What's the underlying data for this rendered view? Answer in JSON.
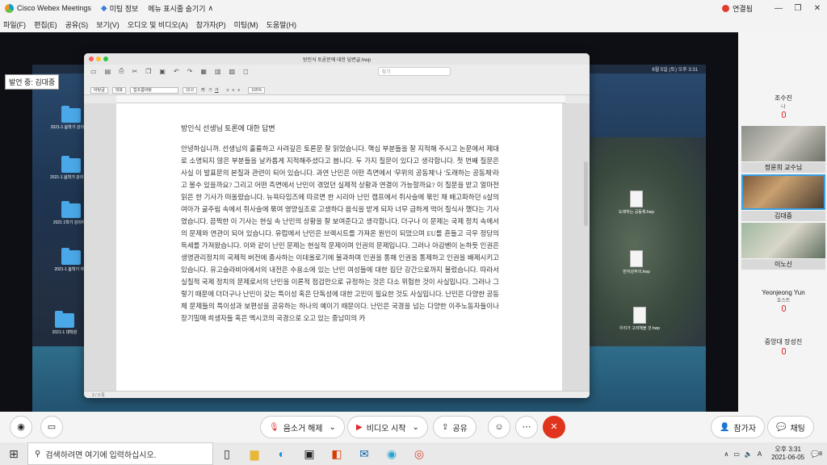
{
  "app": {
    "title": "Cisco Webex Meetings",
    "meeting_info": "미팅 정보",
    "menu_toggle": "메뉴 표시줄 숨기기",
    "connection": "연결됨"
  },
  "menu": [
    "파일(F)",
    "편집(E)",
    "공유(S)",
    "보기(V)",
    "오디오 및 비디오(A)",
    "참가자(P)",
    "미팅(M)",
    "도움말(H)"
  ],
  "presenter_label": "발언 중: 김대중",
  "desktop": {
    "mac_clock": "6월 5일 (토) 오후 3:31",
    "icons": [
      {
        "label": "2021-1 봄학기 강의자료"
      },
      {
        "label": "2021-1 봄학기 강의 자료"
      },
      {
        "label": "2021 1학기 강의자료"
      },
      {
        "label": "2021-1 봄학기 자료"
      },
      {
        "label": "2021-1 대학원"
      },
      {
        "label": "도래하는 공동체.hwp"
      },
      {
        "label": "번지성주의.hwp"
      },
      {
        "label": "우리가 고려해볼 것.hwp"
      }
    ]
  },
  "doc": {
    "window_title": "방인식 토론문에 대한 답변글.hwp",
    "search_placeholder": "찾기",
    "font": "바탕글",
    "style": "대표",
    "font_name": "함초롬바탕",
    "size": "10.0",
    "zoom": "165%",
    "status": "2 / 3 쪽",
    "title": "방인식 선생님 토론에 대한 답변",
    "body": "안녕하십니까. 선생님의 훌륭하고 사려깊은 토론문 잘 읽었습니다. 핵심 부분들을 잘 지적해 주시고 논문에서 제대로 소명되지 않은 부분들을 날카롭게 지적해주셨다고 봅니다. 두 가지 질문이 있다고 생각합니다. 첫 번째 질문은 사실 이 발표문의 본질과 관련이 되어 있습니다. 과연 난민은 어떤 측면에서 '무위의 공동체'나 '도래하는 공동체'라고 볼수 있을까요? 그리고 어떤 측면에서 난민이 겪었던 실제적 상황과 연결이 가능할까요? 이 질문을 받고 얼마전 읽은 한 기사가 떠올랐습니다. 뉴욕타임즈에 따르면 한 시리아 난민 캠프에서 쥐사슬에 묶인 채 배고파하던 6살의 여아가 굶주림 속에서 쥐사슬에 묶여 영양실조로 고생하다 음식을 받게 되자 너무 급하게 먹어 질식사 했다는 기사였습니다. 끔찍한 이 기사는 현실 속 난민의 상황을 잘 보여준다고 생각합니다. 더구나 이 문제는 국제 정치 속에서의 문제와 연관이 되어 있습니다. 유럽에서 난민은 브렉시트를 가져온 원인이 되었으며 EU를 흔들고 극우 정당의 득세를 가져왔습니다. 이와 같이 난민 문제는 현실적 문제이며 인권의 문제입니다. 그러나 아감벤이 논하듯 인권은 생명관리정치의 국제적 버전에 종사하는 이데올로기에 불과하며 인권을 통해 인권을 통제하고 인권을 배제시키고 있습니다. 유고슬라비아에서의 내전은 수용소에 있는 난민 여성들에 대한 집단 강간으로까지 불렀습니다. 따라서 실질적 국제 정치의 문제로서의 난민을 이론적 점검만으로 규정하는 것은 다소 위험한 것이 사실입니다. 그러나 그렇기 때문에 더더구나 난민이 갖는 특이성 혹은 단독성에 대한 고민이 필요한 것도 사실입니다. 난민은 다양한 공동체 문제들의 특이성과 보편성을 공유하는 하나의 예이기 때문이다. 난민은 국경을 넘는 다양한 이주노동자들이나 장기밀매 희생자들 혹은 멕시코의 국경으로 오고 있는 중남미의 카"
  },
  "participants": [
    {
      "name": "조수진",
      "role": "나"
    },
    {
      "name": "정윤희 교수님",
      "role": ""
    },
    {
      "name": "김대중",
      "role": ""
    },
    {
      "name": "이노신",
      "role": ""
    },
    {
      "name": "Yeonjeong Yun",
      "role": "호스트"
    },
    {
      "name": "중앙대 장성진",
      "role": ""
    }
  ],
  "controls": {
    "mute": "음소거 해제",
    "video": "비디오 시작",
    "share": "공유",
    "participants": "참가자",
    "chat": "채팅"
  },
  "taskbar": {
    "search_placeholder": "검색하려면 여기에 입력하십시오.",
    "time": "오후 3:31",
    "date": "2021-06-05",
    "badge": "8"
  }
}
